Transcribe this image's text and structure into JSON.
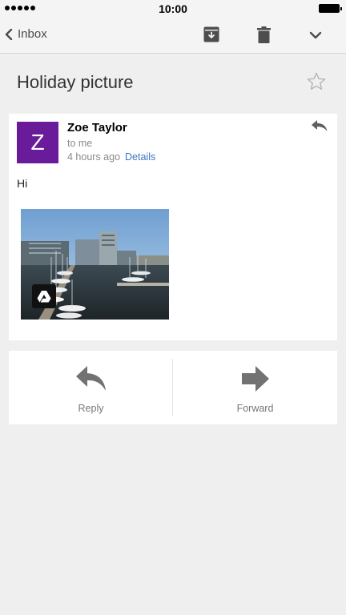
{
  "status_bar": {
    "time": "10:00"
  },
  "toolbar": {
    "back_label": "Inbox",
    "icons": [
      "back-chevron-icon",
      "archive-icon",
      "trash-icon",
      "chevron-down-icon"
    ]
  },
  "message": {
    "subject": "Holiday picture",
    "sender": {
      "name": "Zoe Taylor",
      "avatar_letter": "Z",
      "avatar_color": "#6a1b9a"
    },
    "recipient": "to me",
    "time_ago": "4 hours ago",
    "details_label": "Details",
    "body": "Hi",
    "attachment": {
      "type": "photo",
      "badge_icon": "google-drive-icon"
    }
  },
  "actions": {
    "reply_label": "Reply",
    "forward_label": "Forward"
  },
  "colors": {
    "accent_link": "#3a78c2",
    "background": "#efefef",
    "card": "#ffffff"
  }
}
